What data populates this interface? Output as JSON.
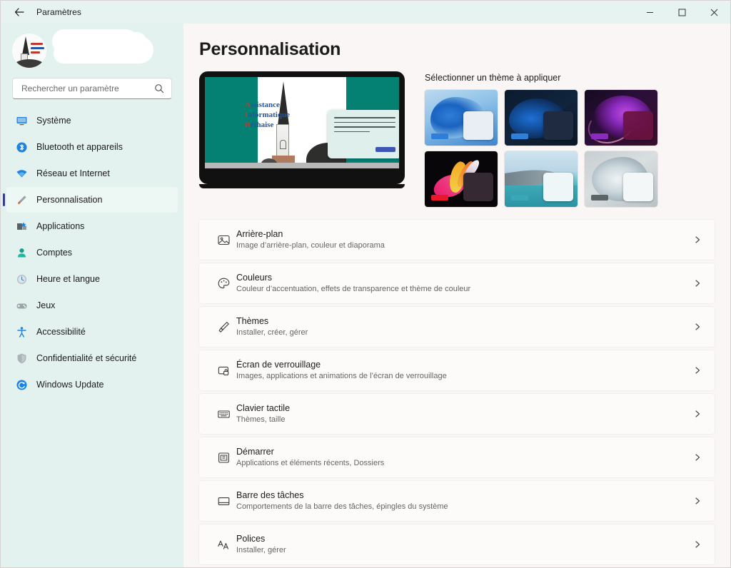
{
  "window": {
    "title": "Paramètres",
    "back_label": "←",
    "minimize_label": "—",
    "maximize_label": "□",
    "close_label": "✕"
  },
  "sidebar": {
    "account_name_redacted": "",
    "avatar_text_lines": [
      "Assistance",
      "Informatique",
      "Réthaise"
    ],
    "search": {
      "placeholder": "Rechercher un paramètre",
      "value": "",
      "icon": "search-icon"
    },
    "items": [
      {
        "label": "Système",
        "icon": "monitor-icon",
        "active": false
      },
      {
        "label": "Bluetooth et appareils",
        "icon": "bluetooth-icon",
        "active": false
      },
      {
        "label": "Réseau et Internet",
        "icon": "wifi-icon",
        "active": false
      },
      {
        "label": "Personnalisation",
        "icon": "paintbrush-icon",
        "active": true
      },
      {
        "label": "Applications",
        "icon": "apps-icon",
        "active": false
      },
      {
        "label": "Comptes",
        "icon": "person-icon",
        "active": false
      },
      {
        "label": "Heure et langue",
        "icon": "clock-icon",
        "active": false
      },
      {
        "label": "Jeux",
        "icon": "gamepad-icon",
        "active": false
      },
      {
        "label": "Accessibilité",
        "icon": "accessibility-icon",
        "active": false
      },
      {
        "label": "Confidentialité et sécurité",
        "icon": "shield-icon",
        "active": false
      },
      {
        "label": "Windows Update",
        "icon": "update-icon",
        "active": false
      }
    ]
  },
  "main": {
    "page_title": "Personnalisation",
    "preview": {
      "wallpaper_text": [
        "Assistance",
        "Informatique",
        "Réthaise"
      ],
      "background_color": "#058174",
      "accent_color": "#3d56b2"
    },
    "themes": {
      "label": "Sélectionner un thème à appliquer",
      "items": [
        {
          "name": "windows-bloom-light",
          "accent": "#2f7ed8"
        },
        {
          "name": "windows-bloom-dark",
          "accent": "#2f7ed8"
        },
        {
          "name": "glow-purple",
          "accent": "#8a2bbd"
        },
        {
          "name": "captured-motion-dark",
          "accent": "#e8172a"
        },
        {
          "name": "sunrise-lake",
          "accent": "#3aa7b8"
        },
        {
          "name": "flow-light",
          "accent": "#5c6468"
        }
      ]
    },
    "settings_rows": [
      {
        "title": "Arrière-plan",
        "subtitle": "Image d’arrière-plan, couleur et diaporama",
        "icon": "image-icon"
      },
      {
        "title": "Couleurs",
        "subtitle": "Couleur d’accentuation, effets de transparence et thème de couleur",
        "icon": "palette-icon"
      },
      {
        "title": "Thèmes",
        "subtitle": "Installer, créer, gérer",
        "icon": "paintbrush-icon"
      },
      {
        "title": "Écran de verrouillage",
        "subtitle": "Images, applications et animations de l’écran de verrouillage",
        "icon": "lockscreen-icon"
      },
      {
        "title": "Clavier tactile",
        "subtitle": "Thèmes, taille",
        "icon": "keyboard-icon"
      },
      {
        "title": "Démarrer",
        "subtitle": "Applications et éléments récents, Dossiers",
        "icon": "start-icon"
      },
      {
        "title": "Barre des tâches",
        "subtitle": "Comportements de la barre des tâches, épingles du système",
        "icon": "taskbar-icon"
      },
      {
        "title": "Polices",
        "subtitle": "Installer, gérer",
        "icon": "fonts-icon"
      }
    ],
    "chevron": "›"
  }
}
